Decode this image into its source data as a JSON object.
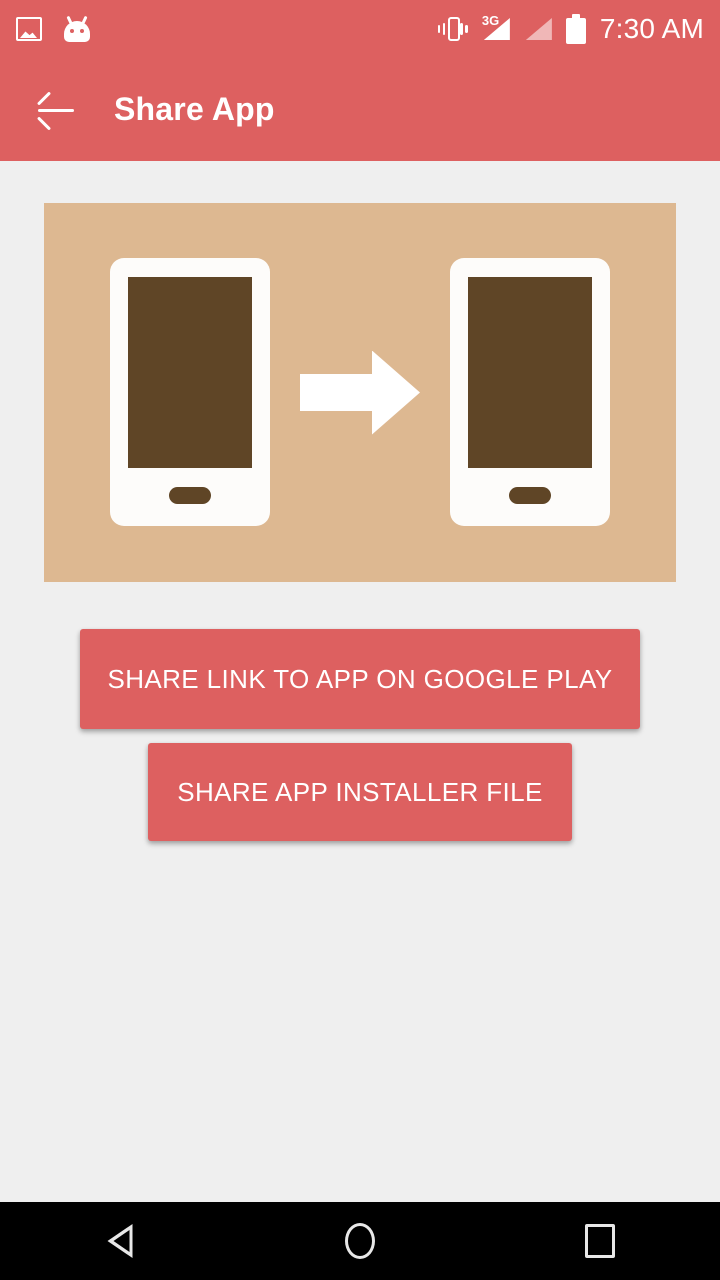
{
  "colors": {
    "primary": "#dd6060",
    "banner_bg": "#ddb891",
    "page_bg": "#efefef",
    "phone_body": "#fdfcfa",
    "phone_screen": "#5f4526",
    "nav_bg": "#000000",
    "icon_white": "#ffffff"
  },
  "status_bar": {
    "left_icons": [
      {
        "name": "photo-icon"
      },
      {
        "name": "android-head-icon"
      }
    ],
    "right_icons": [
      {
        "name": "vibrate-icon"
      },
      {
        "name": "signal-3g-icon",
        "label": "3G"
      },
      {
        "name": "signal-icon"
      },
      {
        "name": "battery-icon"
      }
    ],
    "clock": "7:30 AM"
  },
  "app_bar": {
    "back_label": "back-arrow",
    "title": "Share App"
  },
  "banner": {
    "illustration_name": "two-phones-transfer-illustration",
    "left_phone": "source-phone",
    "right_phone": "destination-phone",
    "arrow": "transfer-arrow"
  },
  "buttons": {
    "share_play_label": "SHARE LINK TO APP ON GOOGLE PLAY",
    "share_installer_label": "SHARE APP INSTALLER FILE"
  },
  "nav_bar": {
    "back": "back-nav",
    "home": "home-nav",
    "recents": "recents-nav"
  }
}
